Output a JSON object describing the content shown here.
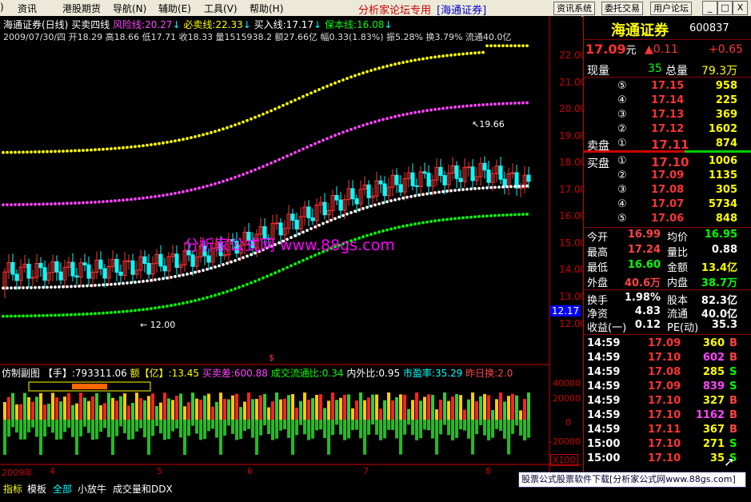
{
  "menu": [
    "资讯",
    "港股期货",
    "导航(N)",
    "辅助(E)",
    "工具(V)",
    "帮助(H)"
  ],
  "banner": {
    "left": "分析家论坛专用",
    "right": "[海通证券]"
  },
  "toolbar": [
    "资讯系统",
    "委托交易",
    "用户论坛"
  ],
  "window_buttons": [
    "_",
    "□",
    "X"
  ],
  "chart_header": {
    "line1": [
      {
        "text": "海通证券(日线)",
        "color": "#ffffff"
      },
      {
        "text": "买卖四线",
        "color": "#ffffff"
      },
      {
        "text": "风险线:20.27",
        "color": "#ff44ff"
      },
      {
        "text": "必卖线:22.33",
        "color": "#ffff00"
      },
      {
        "text": "买入线:17.17",
        "color": "#ffffff"
      },
      {
        "text": "保本线:16.08",
        "color": "#00ff00"
      }
    ],
    "line2": "2009/07/30/四 开18.29 高18.66 低17.71 收18.33 量1515938.2 额27.66亿 幅0.33(1.83%) 振5.28% 换3.79% 流通40.0亿"
  },
  "watermark": "分析家公式网 www.88gs.com",
  "price_axis": [
    "22.00",
    "21.00",
    "20.00",
    "19.00",
    "18.00",
    "17.00",
    "16.00",
    "15.00",
    "14.00",
    "13.00",
    "12.00"
  ],
  "current_price_tag": "12.17",
  "hi_label": "19.66",
  "lo_label": "12.00",
  "sub_header": [
    {
      "text": "仿制副图",
      "color": "#ffffff"
    },
    {
      "text": "【手】:793311.06",
      "color": "#ffffff"
    },
    {
      "text": "额【亿】:13.45",
      "color": "#ffff00"
    },
    {
      "text": "买卖差:600.88",
      "color": "#ff44ff"
    },
    {
      "text": "成交流通比:0.34",
      "color": "#00ff00"
    },
    {
      "text": "内外比:0.95",
      "color": "#ffffff"
    },
    {
      "text": "市盈率:35.29",
      "color": "#00ffff"
    },
    {
      "text": "昨日换:2.0",
      "color": "#ff4444"
    }
  ],
  "sub_axis": [
    "40000",
    "20000",
    "0",
    "-20000"
  ],
  "sub_axis_unit": "X100",
  "date_axis": [
    "2009年",
    "4",
    "5",
    "6",
    "7",
    "8"
  ],
  "bottom_tabs": [
    "指标",
    "模板",
    "全部",
    "小放牛",
    "成交量和DDX"
  ],
  "ad_text": "股票公式股票软件下载[分析家公式网www.88gs.com]",
  "quote": {
    "name": "海通证券",
    "code": "600837",
    "price": "17.09",
    "price_unit": "元",
    "change": "▲0.11",
    "pct": "+0.65",
    "xianliang_label": "现量",
    "xianliang": "35",
    "zongliang_label": "总量",
    "zongliang": "79.3万",
    "sell_label": "卖盘",
    "buy_label": "买盘",
    "sells": [
      {
        "lvl": "⑤",
        "price": "17.15",
        "vol": "958"
      },
      {
        "lvl": "④",
        "price": "17.14",
        "vol": "225"
      },
      {
        "lvl": "③",
        "price": "17.13",
        "vol": "369"
      },
      {
        "lvl": "②",
        "price": "17.12",
        "vol": "1602"
      },
      {
        "lvl": "①",
        "price": "17.11",
        "vol": "874"
      }
    ],
    "buys": [
      {
        "lvl": "①",
        "price": "17.10",
        "vol": "1006"
      },
      {
        "lvl": "②",
        "price": "17.09",
        "vol": "1135"
      },
      {
        "lvl": "③",
        "price": "17.08",
        "vol": "305"
      },
      {
        "lvl": "④",
        "price": "17.07",
        "vol": "5734"
      },
      {
        "lvl": "⑤",
        "price": "17.06",
        "vol": "848"
      }
    ],
    "stats": [
      {
        "l1": "今开",
        "v1": "16.99",
        "c1": "#ff4444",
        "l2": "均价",
        "v2": "16.95",
        "c2": "#00ff00"
      },
      {
        "l1": "最高",
        "v1": "17.24",
        "c1": "#ff4444",
        "l2": "量比",
        "v2": "0.88",
        "c2": "#ffffff"
      },
      {
        "l1": "最低",
        "v1": "16.60",
        "c1": "#00ff00",
        "l2": "金额",
        "v2": "13.4亿",
        "c2": "#ffff00"
      },
      {
        "l1": "外盘",
        "v1": "40.6万",
        "c1": "#ff4444",
        "l2": "内盘",
        "v2": "38.7万",
        "c2": "#00ff00"
      }
    ],
    "stats2": [
      {
        "l1": "换手",
        "v1": "1.98%",
        "l2": "股本",
        "v2": "82.3亿"
      },
      {
        "l1": "净资",
        "v1": "4.83",
        "l2": "流通",
        "v2": "40.0亿"
      },
      {
        "l1": "收益(一)",
        "v1": "0.12",
        "l2": "PE(动)",
        "v2": "35.3"
      }
    ],
    "ticks": [
      {
        "time": "14:59",
        "price": "17.09",
        "vol": "360",
        "side": "B",
        "vc": "#ffff00",
        "sc": "#ff4444"
      },
      {
        "time": "14:59",
        "price": "17.10",
        "vol": "602",
        "side": "B",
        "vc": "#ff44ff",
        "sc": "#ff4444"
      },
      {
        "time": "14:59",
        "price": "17.08",
        "vol": "285",
        "side": "S",
        "vc": "#ffff00",
        "sc": "#00ff00"
      },
      {
        "time": "14:59",
        "price": "17.09",
        "vol": "839",
        "side": "S",
        "vc": "#ff44ff",
        "sc": "#00ff00"
      },
      {
        "time": "14:59",
        "price": "17.10",
        "vol": "327",
        "side": "B",
        "vc": "#ffff00",
        "sc": "#ff4444"
      },
      {
        "time": "14:59",
        "price": "17.10",
        "vol": "1162",
        "side": "B",
        "vc": "#ff44ff",
        "sc": "#ff4444"
      },
      {
        "time": "14:59",
        "price": "17.11",
        "vol": "367",
        "side": "B",
        "vc": "#ffff00",
        "sc": "#ff4444"
      },
      {
        "time": "15:00",
        "price": "17.10",
        "vol": "271",
        "side": "S",
        "vc": "#ffff00",
        "sc": "#00ff00"
      },
      {
        "time": "15:00",
        "price": "17.10",
        "vol": "35",
        "side": "S",
        "vc": "#ffff00",
        "sc": "#00ff00"
      }
    ]
  },
  "colors": {
    "up": "#ff3333",
    "down": "#00ffff",
    "accent": "#c00000"
  }
}
